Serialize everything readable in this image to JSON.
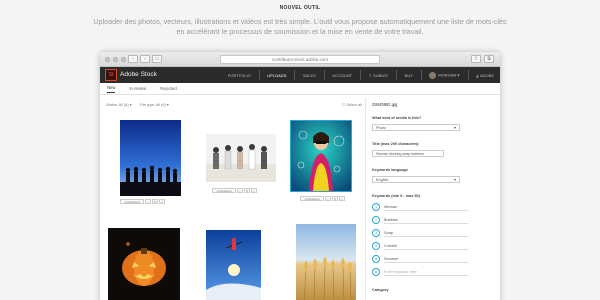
{
  "hero": {
    "label": "NOUVEL OUTIL",
    "text": "Uploader des photos, vecteurs, illustrations et vidéos est très simple. L'outil vous propose automatiquement une liste de mots-clés en accélérant le processus de soumission et la mise en vente de votre travail."
  },
  "browser": {
    "url": "contributor.stock.adobe.com",
    "nav_back": "‹",
    "nav_forward": "›"
  },
  "app": {
    "logo": "St",
    "brand": "Adobe Stock",
    "nav": [
      "PORTFOLIO",
      "UPLOADS",
      "SALES",
      "ACCOUNT",
      "SUBMIT",
      "BUY"
    ],
    "active_nav": "UPLOADS",
    "user": "MORGAN",
    "adobe": "Adobe",
    "tabs": [
      "New",
      "In review",
      "Rejected"
    ],
    "active_tab": "New"
  },
  "filters": {
    "status": "Status: All (6)",
    "file_type": "File type: All (6)",
    "select_all": "Select all"
  },
  "thumbnails": [
    {
      "ctl": "contributed",
      "icon": "people-silhouette-sunset"
    },
    {
      "ctl": "contributed",
      "icon": "people-on-beach"
    },
    {
      "ctl": "contributed",
      "icon": "woman-party-bubbles"
    },
    {
      "ctl": "",
      "icon": "pumpkin-lantern"
    },
    {
      "ctl": "",
      "icon": "skier-jump"
    },
    {
      "ctl": "",
      "icon": "wheat-field"
    }
  ],
  "panel": {
    "filename": "29045982.jpg",
    "media_q": "What kind of media is this?",
    "media_value": "Photo",
    "title_label": "Title (max 200 characters)",
    "title_value": "Woman blowing soap bubbles",
    "lang_label": "Keywords language",
    "lang_value": "English",
    "kw_label": "Keywords (min 5 - max 50)",
    "keywords": [
      "Woman",
      "Bubbles",
      "Soap",
      "Colorful",
      "Summer"
    ],
    "kw_placeholder": "Enter keyword here",
    "category_label": "Category"
  },
  "colors": {
    "appbar": "#2b2b2b",
    "accent": "#2aa4d4",
    "selected_border": "#2aa4d4"
  }
}
